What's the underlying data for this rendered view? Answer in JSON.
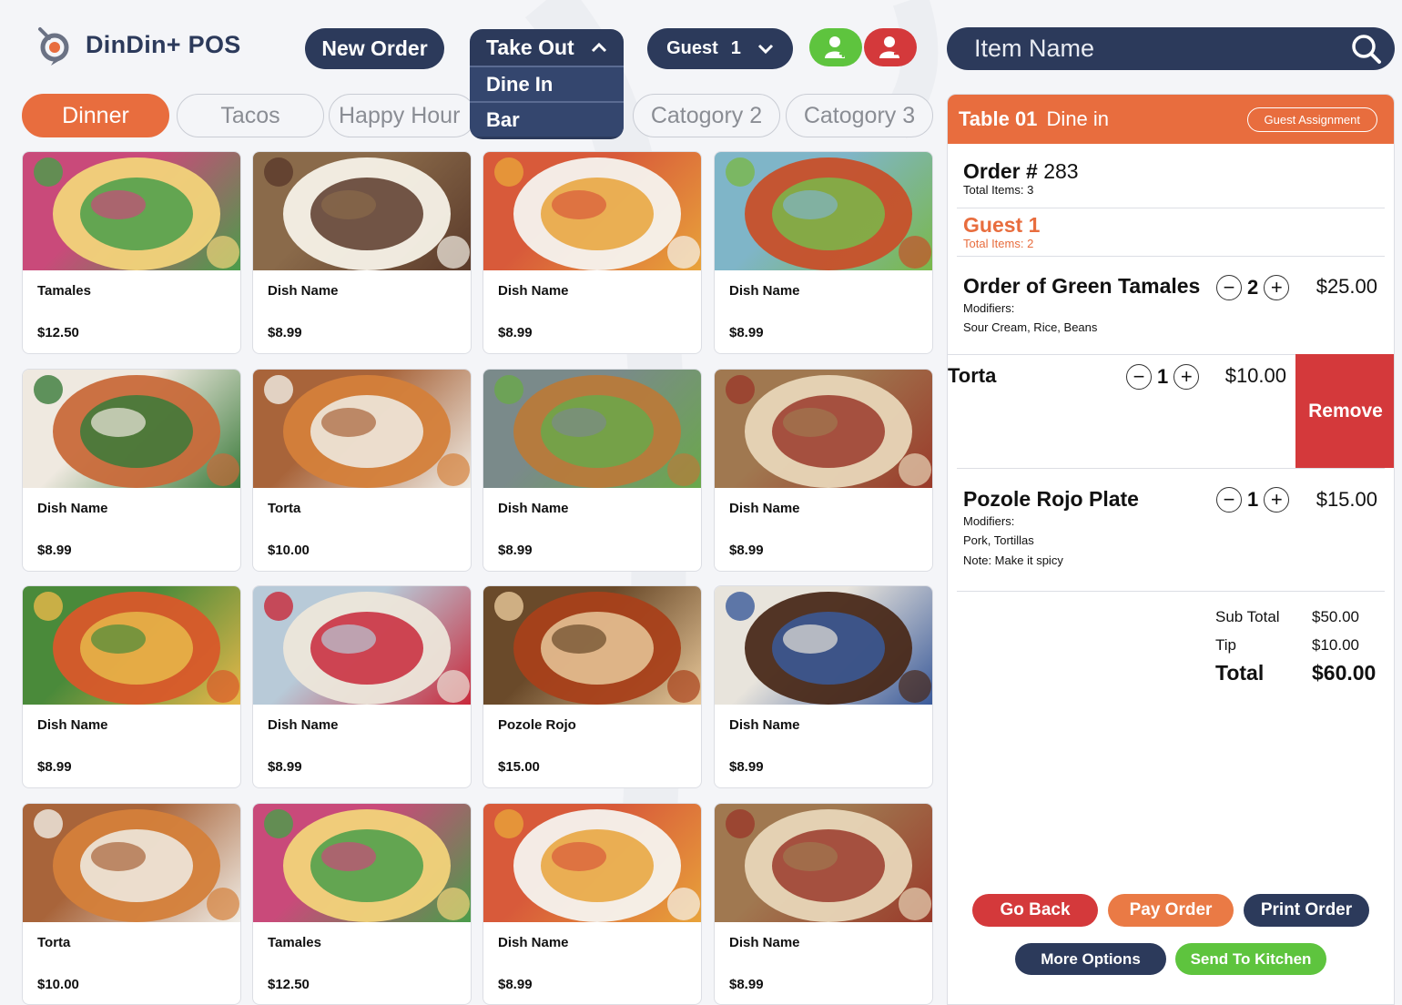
{
  "app": {
    "title": "DinDin+ POS"
  },
  "header": {
    "new_order_label": "New Order",
    "order_type": {
      "selected": "Take Out",
      "options": [
        "Dine In",
        "Bar"
      ]
    },
    "guest": {
      "label": "Guest",
      "number": "1"
    },
    "search_placeholder": "Item Name"
  },
  "categories": [
    {
      "label": "Dinner",
      "active": true
    },
    {
      "label": "Tacos",
      "active": false
    },
    {
      "label": "Happy Hour",
      "active": false
    },
    {
      "label": "Catogory 2",
      "active": false
    },
    {
      "label": "Catogory 3",
      "active": false
    }
  ],
  "menu": [
    {
      "name": "Tamales",
      "price": "$12.50",
      "img": "tamales"
    },
    {
      "name": "Dish Name",
      "price": "$8.99",
      "img": "steak"
    },
    {
      "name": "Dish Name",
      "price": "$8.99",
      "img": "plate"
    },
    {
      "name": "Dish Name",
      "price": "$8.99",
      "img": "skillet"
    },
    {
      "name": "Dish Name",
      "price": "$8.99",
      "img": "bowl"
    },
    {
      "name": "Torta",
      "price": "$10.00",
      "img": "torta"
    },
    {
      "name": "Dish Name",
      "price": "$8.99",
      "img": "tacos"
    },
    {
      "name": "Dish Name",
      "price": "$8.99",
      "img": "sandwich"
    },
    {
      "name": "Dish Name",
      "price": "$8.99",
      "img": "enchilada"
    },
    {
      "name": "Dish Name",
      "price": "$8.99",
      "img": "chile"
    },
    {
      "name": "Pozole Rojo",
      "price": "$15.00",
      "img": "pozole"
    },
    {
      "name": "Dish Name",
      "price": "$8.99",
      "img": "mole"
    },
    {
      "name": "Torta",
      "price": "$10.00",
      "img": "torta"
    },
    {
      "name": "Tamales",
      "price": "$12.50",
      "img": "tamales"
    },
    {
      "name": "Dish Name",
      "price": "$8.99",
      "img": "plate"
    },
    {
      "name": "Dish Name",
      "price": "$8.99",
      "img": "sandwich"
    }
  ],
  "order": {
    "table_label": "Table 01",
    "service": "Dine in",
    "guest_assignment_label": "Guest Assignment",
    "order_label": "Order #",
    "order_number": "283",
    "total_items": "Total Items: 3",
    "guest_name": "Guest 1",
    "guest_items": "Total Items: 2",
    "items": [
      {
        "name": "Order of Green Tamales",
        "qty": "2",
        "price": "$25.00",
        "modifiers_label": "Modifiers:",
        "modifiers": "Sour Cream, Rice, Beans",
        "note": ""
      },
      {
        "name": "Torta",
        "qty": "1",
        "price": "$10.00",
        "modifiers_label": "",
        "modifiers": "",
        "note": ""
      },
      {
        "name": "Pozole Rojo Plate",
        "qty": "1",
        "price": "$15.00",
        "modifiers_label": "Modifiers:",
        "modifiers": "Pork, Tortillas",
        "note": "Note: Make it spicy"
      }
    ],
    "remove_label": "Remove",
    "subtotal_label": "Sub Total",
    "subtotal": "$50.00",
    "tip_label": "Tip",
    "tip": "$10.00",
    "total_label": "Total",
    "total": "$60.00"
  },
  "actions": {
    "go_back": "Go Back",
    "pay_order": "Pay Order",
    "print_order": "Print Order",
    "more_options": "More Options",
    "send_to_kitchen": "Send To Kitchen"
  },
  "colors": {
    "accent": "#e86d3e",
    "navy": "#2c3a5b",
    "red": "#d4393b",
    "green": "#5ec43e"
  }
}
